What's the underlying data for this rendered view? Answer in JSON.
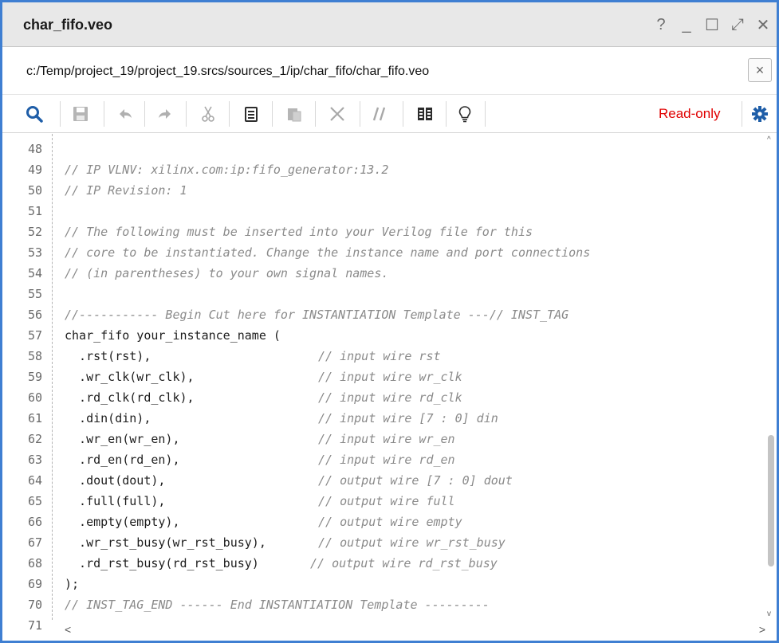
{
  "window": {
    "title": "char_fifo.veo",
    "controls": [
      "?",
      "_",
      "☐",
      "⤢",
      "✕"
    ]
  },
  "path": {
    "text": "c:/Temp/project_19/project_19.srcs/sources_1/ip/char_fifo/char_fifo.veo",
    "close": "×"
  },
  "toolbar": {
    "status": "Read-only",
    "icons": [
      "search-icon",
      "save-icon",
      "undo-icon",
      "redo-icon",
      "cut-icon",
      "copy-icon",
      "paste-icon",
      "delete-icon",
      "comment-icon",
      "columns-icon",
      "lightbulb-icon",
      "settings-icon"
    ],
    "accent": "#e00000"
  },
  "editor": {
    "lines": [
      {
        "n": "48",
        "code": "",
        "type": "code"
      },
      {
        "n": "49",
        "code": "// IP VLNV: xilinx.com:ip:fifo_generator:13.2",
        "type": "comment"
      },
      {
        "n": "50",
        "code": "// IP Revision: 1",
        "type": "comment"
      },
      {
        "n": "51",
        "code": "",
        "type": "code"
      },
      {
        "n": "52",
        "code": "// The following must be inserted into your Verilog file for this",
        "type": "comment"
      },
      {
        "n": "53",
        "code": "// core to be instantiated. Change the instance name and port connections",
        "type": "comment"
      },
      {
        "n": "54",
        "code": "// (in parentheses) to your own signal names.",
        "type": "comment"
      },
      {
        "n": "55",
        "code": "",
        "type": "code"
      },
      {
        "n": "56",
        "code": "//----------- Begin Cut here for INSTANTIATION Template ---// INST_TAG",
        "type": "comment"
      },
      {
        "n": "57",
        "code": "char_fifo your_instance_name (",
        "type": "code"
      },
      {
        "n": "58",
        "code": "  .rst(rst),",
        "comment": "// input wire rst",
        "type": "mixed"
      },
      {
        "n": "59",
        "code": "  .wr_clk(wr_clk),",
        "comment": "// input wire wr_clk",
        "type": "mixed"
      },
      {
        "n": "60",
        "code": "  .rd_clk(rd_clk),",
        "comment": "// input wire rd_clk",
        "type": "mixed"
      },
      {
        "n": "61",
        "code": "  .din(din),",
        "comment": "// input wire [7 : 0] din",
        "type": "mixed"
      },
      {
        "n": "62",
        "code": "  .wr_en(wr_en),",
        "comment": "// input wire wr_en",
        "type": "mixed"
      },
      {
        "n": "63",
        "code": "  .rd_en(rd_en),",
        "comment": "// input wire rd_en",
        "type": "mixed"
      },
      {
        "n": "64",
        "code": "  .dout(dout),",
        "comment": "// output wire [7 : 0] dout",
        "type": "mixed"
      },
      {
        "n": "65",
        "code": "  .full(full),",
        "comment": "// output wire full",
        "type": "mixed"
      },
      {
        "n": "66",
        "code": "  .empty(empty),",
        "comment": "// output wire empty",
        "type": "mixed"
      },
      {
        "n": "67",
        "code": "  .wr_rst_busy(wr_rst_busy),",
        "comment": "// output wire wr_rst_busy",
        "type": "mixed"
      },
      {
        "n": "68",
        "code": "  .rd_rst_busy(rd_rst_busy)",
        "comment": "// output wire rd_rst_busy",
        "type": "mixed",
        "gap": "  "
      },
      {
        "n": "69",
        "code": ");",
        "type": "code"
      },
      {
        "n": "70",
        "code": "// INST_TAG_END ------ End INSTANTIATION Template ---------",
        "type": "comment"
      },
      {
        "n": "71",
        "code": "",
        "type": "code"
      }
    ]
  }
}
